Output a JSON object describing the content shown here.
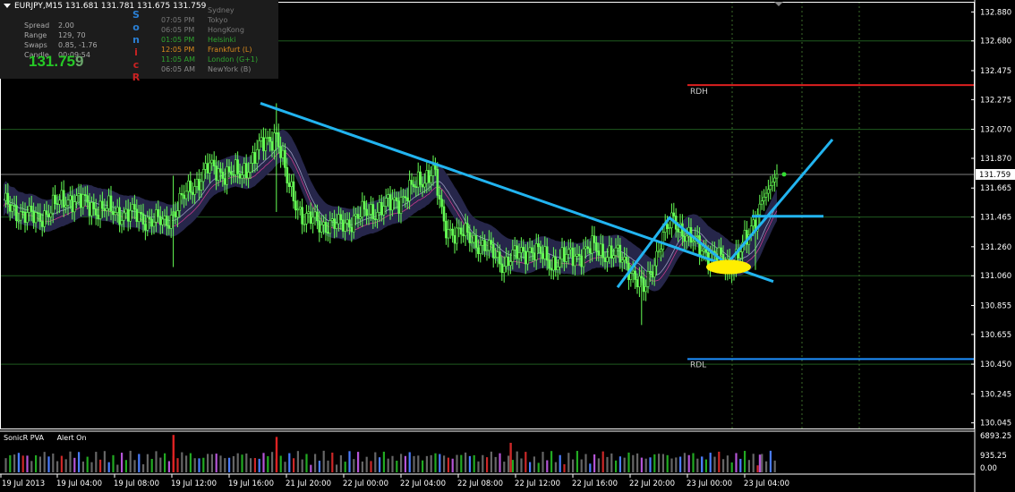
{
  "symbol_line": "EURJPY,M15  131.681 131.781 131.675 131.759",
  "hud": {
    "stats": [
      {
        "key": "Spread",
        "value": "2.00"
      },
      {
        "key": "Range",
        "value": "129, 70"
      },
      {
        "key": "Swaps",
        "value": "0.85, -1.76"
      },
      {
        "key": "Candle",
        "value": "00:09:54"
      }
    ],
    "price_main": "131.75",
    "price_last": "9",
    "brand_letters": [
      {
        "ch": "S",
        "color": "#2a7fd4"
      },
      {
        "ch": "o",
        "color": "#2a7fd4"
      },
      {
        "ch": "n",
        "color": "#2a7fd4"
      },
      {
        "ch": "i",
        "color": "#cc2222"
      },
      {
        "ch": "c",
        "color": "#cc2222"
      },
      {
        "ch": "R",
        "color": "#cc2222"
      }
    ],
    "sessions": [
      {
        "time": "",
        "city": "Sydney",
        "color": "#777777"
      },
      {
        "time": "07:05 PM",
        "city": "Tokyo",
        "color": "#777777"
      },
      {
        "time": "06:05 PM",
        "city": "HongKong",
        "color": "#777777"
      },
      {
        "time": "01:05 PM",
        "city": "Helsinki",
        "color": "#2fa32f"
      },
      {
        "time": "12:05 PM",
        "city": "Frankfurt  (L)",
        "color": "#d98a1c"
      },
      {
        "time": "11:05 AM",
        "city": "London  (G+1)",
        "color": "#2fa32f"
      },
      {
        "time": "06:05 AM",
        "city": "NewYork  (B)",
        "color": "#888888"
      }
    ]
  },
  "indicator": {
    "name": "SonicR PVA",
    "status": "Alert On"
  },
  "chart_data": {
    "type": "candlestick",
    "symbol": "EURJPY",
    "timeframe": "M15",
    "y_ticks": [
      "132.880",
      "132.680",
      "132.475",
      "132.275",
      "132.070",
      "131.870",
      "131.665",
      "131.465",
      "131.260",
      "131.060",
      "130.855",
      "130.655",
      "130.450",
      "130.245",
      "130.045"
    ],
    "x_ticks": [
      "19 Jul 2013",
      "19 Jul 04:00",
      "19 Jul 08:00",
      "19 Jul 12:00",
      "19 Jul 16:00",
      "21 Jul 20:00",
      "22 Jul 00:00",
      "22 Jul 04:00",
      "22 Jul 08:00",
      "22 Jul 12:00",
      "22 Jul 16:00",
      "22 Jul 20:00",
      "23 Jul 00:00",
      "23 Jul 04:00"
    ],
    "ylim": [
      130.0,
      132.95
    ],
    "current_price": "131.759",
    "levels": [
      {
        "label": "RDH",
        "price": 132.375,
        "color": "#dd2020"
      },
      {
        "label": "RDL",
        "price": 130.485,
        "color": "#1e90ff"
      }
    ],
    "close_anchors": [
      [
        0,
        131.55
      ],
      [
        15,
        131.45
      ],
      [
        30,
        131.6
      ],
      [
        45,
        131.52
      ],
      [
        60,
        131.48
      ],
      [
        75,
        131.42
      ],
      [
        85,
        131.62
      ],
      [
        95,
        131.8
      ],
      [
        110,
        131.75
      ],
      [
        120,
        131.95
      ],
      [
        127,
        132.05
      ],
      [
        132,
        131.7
      ],
      [
        140,
        131.45
      ],
      [
        155,
        131.4
      ],
      [
        170,
        131.5
      ],
      [
        180,
        131.55
      ],
      [
        190,
        131.65
      ],
      [
        200,
        131.8
      ],
      [
        205,
        131.4
      ],
      [
        220,
        131.3
      ],
      [
        233,
        131.15
      ],
      [
        245,
        131.25
      ],
      [
        255,
        131.15
      ],
      [
        265,
        131.2
      ],
      [
        275,
        131.25
      ],
      [
        285,
        131.2
      ],
      [
        290,
        131.15
      ],
      [
        298,
        130.95
      ],
      [
        306,
        131.3
      ],
      [
        312,
        131.45
      ],
      [
        320,
        131.3
      ],
      [
        330,
        131.2
      ],
      [
        338,
        131.12
      ],
      [
        346,
        131.3
      ],
      [
        352,
        131.55
      ],
      [
        360,
        131.76
      ]
    ],
    "volume_ymax": "6893.25",
    "volume_ymin": "0.00",
    "volume_mid": "935.25"
  }
}
